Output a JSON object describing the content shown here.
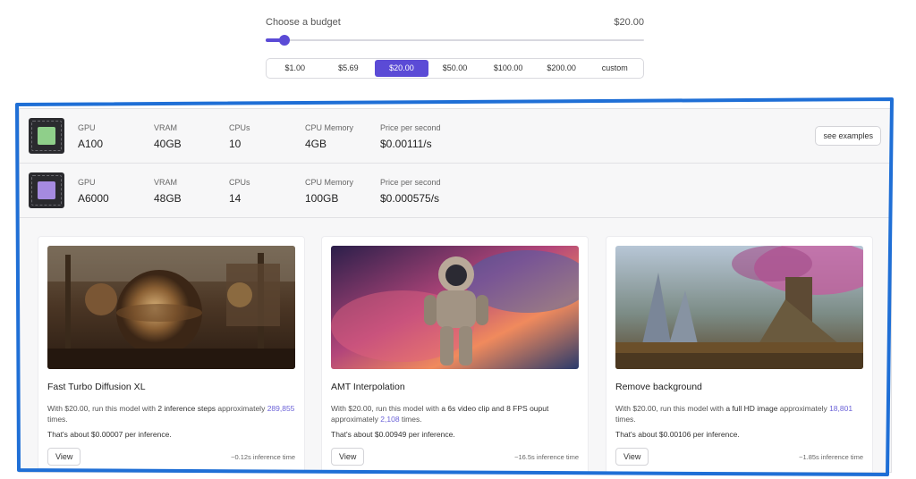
{
  "budget": {
    "label": "Choose a budget",
    "value": "$20.00",
    "slider_fraction": 0.05,
    "options": [
      {
        "label": "$1.00",
        "active": false
      },
      {
        "label": "$5.69",
        "active": false
      },
      {
        "label": "$20.00",
        "active": true
      },
      {
        "label": "$50.00",
        "active": false
      },
      {
        "label": "$100.00",
        "active": false
      },
      {
        "label": "$200.00",
        "active": false
      },
      {
        "label": "custom",
        "active": false
      }
    ]
  },
  "gpus": [
    {
      "gpu_label": "GPU",
      "gpu": "A100",
      "vram_label": "VRAM",
      "vram": "40GB",
      "cpus_label": "CPUs",
      "cpus": "10",
      "mem_label": "CPU Memory",
      "mem": "4GB",
      "price_label": "Price per second",
      "price": "$0.00111/s",
      "button": "see examples",
      "die_color": "#8fcf8a"
    },
    {
      "gpu_label": "GPU",
      "gpu": "A6000",
      "vram_label": "VRAM",
      "vram": "48GB",
      "cpus_label": "CPUs",
      "cpus": "14",
      "mem_label": "CPU Memory",
      "mem": "100GB",
      "price_label": "Price per second",
      "price": "$0.000575/s",
      "die_color": "#a58ae0"
    }
  ],
  "cards": [
    {
      "title": "Fast Turbo Diffusion XL",
      "desc_pre": "With $20.00, run this model with ",
      "desc_bold": "2 inference steps",
      "desc_mid": " approximately ",
      "count": "289,855",
      "desc_post": " times.",
      "cost_pre": "That's about ",
      "cost": "$0.00007",
      "cost_post": " per inference.",
      "button": "View",
      "time": "~0.12s inference time"
    },
    {
      "title": "AMT Interpolation",
      "desc_pre": "With $20.00, run this model with ",
      "desc_bold": "a 6s video clip and 8 FPS ouput",
      "desc_mid": " approximately ",
      "count": "2,108",
      "desc_post": " times.",
      "cost_pre": "That's about ",
      "cost": "$0.00949",
      "cost_post": " per inference.",
      "button": "View",
      "time": "~16.5s inference time"
    },
    {
      "title": "Remove background",
      "desc_pre": "With $20.00, run this model with ",
      "desc_bold": "a full HD image",
      "desc_mid": " approximately ",
      "count": "18,801",
      "desc_post": " times.",
      "cost_pre": "That's about ",
      "cost": "$0.00106",
      "cost_post": " per inference.",
      "button": "View",
      "time": "~1.85s inference time"
    }
  ],
  "colors": {
    "accent": "#5b4bd6",
    "annotation": "#1f6fd6"
  }
}
